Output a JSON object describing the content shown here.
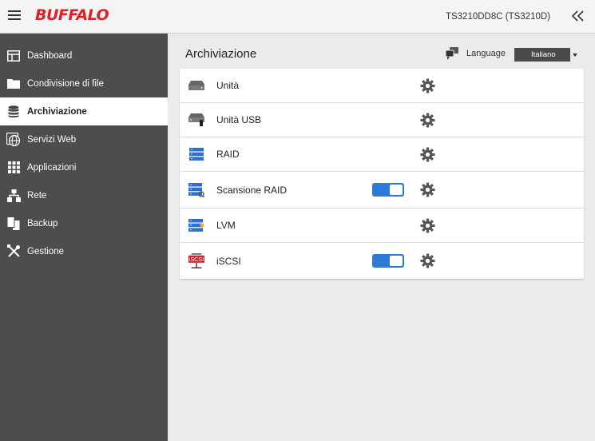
{
  "header": {
    "brand": "BUFFALO",
    "model": "TS3210DD8C (TS3210D)",
    "brand_color": "#e01f26"
  },
  "sidebar": {
    "items": [
      {
        "label": "Dashboard",
        "icon": "dashboard-icon"
      },
      {
        "label": "Condivisione di file",
        "icon": "folder-icon"
      },
      {
        "label": "Archiviazione",
        "icon": "database-icon",
        "active": true
      },
      {
        "label": "Servizi Web",
        "icon": "globe-icon"
      },
      {
        "label": "Applicazioni",
        "icon": "apps-grid-icon"
      },
      {
        "label": "Rete",
        "icon": "network-icon"
      },
      {
        "label": "Backup",
        "icon": "backup-icon"
      },
      {
        "label": "Gestione",
        "icon": "tools-icon"
      }
    ]
  },
  "main": {
    "title": "Archiviazione",
    "language_label": "Language",
    "language_value": "Italiano",
    "rows": [
      {
        "label": "Unità",
        "icon": "drive-icon",
        "toggle": null
      },
      {
        "label": "Unità USB",
        "icon": "usb-drive-icon",
        "toggle": null
      },
      {
        "label": "RAID",
        "icon": "raid-icon",
        "toggle": null
      },
      {
        "label": "Scansione RAID",
        "icon": "raid-scan-icon",
        "toggle": true
      },
      {
        "label": "LVM",
        "icon": "lvm-icon",
        "toggle": null
      },
      {
        "label": "iSCSI",
        "icon": "iscsi-icon",
        "icon_text": "iSCSI",
        "toggle": true
      }
    ]
  },
  "colors": {
    "sidebar_bg": "#4d4d4d",
    "accent_blue": "#2c79d6",
    "main_bg": "#ebebeb"
  }
}
